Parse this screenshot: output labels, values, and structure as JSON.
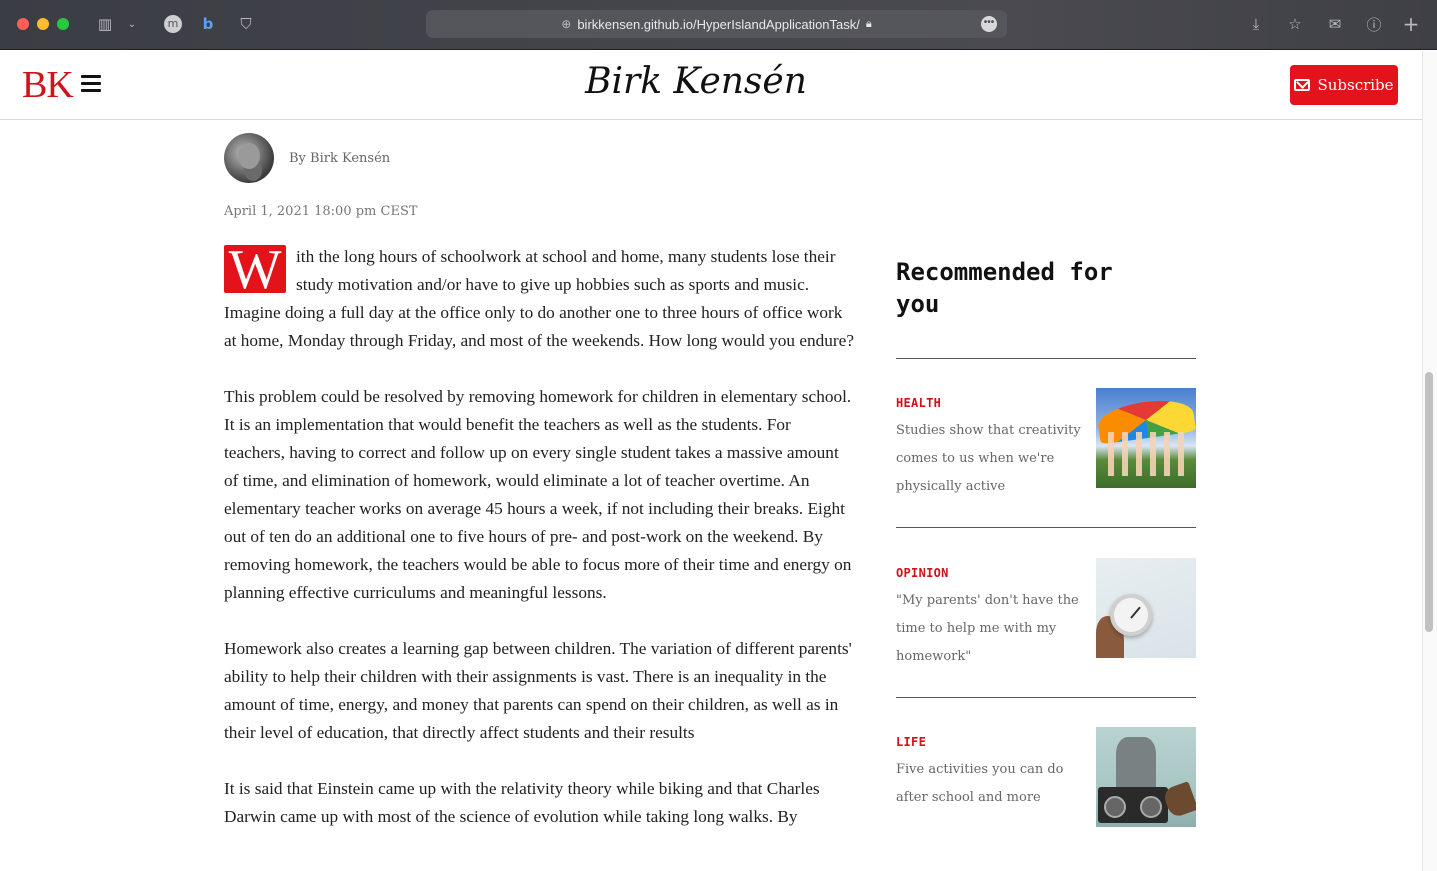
{
  "browser": {
    "url": "birkkensen.github.io/HyperIslandApplicationTask/",
    "more_label": "•••"
  },
  "header": {
    "logo": "BK",
    "site_title": "Birk Kensén",
    "subscribe_label": "Subscribe"
  },
  "article": {
    "author": "By Birk Kensén",
    "date": "April 1, 2021 18:00 pm CEST",
    "dropcap": "W",
    "paragraphs": [
      "ith the long hours of schoolwork at school and home, many students lose their study motivation and/or have to give up hobbies such as sports and music. Imagine doing a full day at the office only to do another one to three hours of office work at home, Monday through Friday, and most of the weekends. How long would you endure?",
      "This problem could be resolved by removing homework for children in elementary school. It is an implementation that would benefit the teachers as well as the students. For teachers, having to correct and follow up on every single student takes a massive amount of time, and elimination of homework, would eliminate a lot of teacher overtime. An elementary teacher works on average 45 hours a week, if not including their breaks. Eight out of ten do an additional one to five hours of pre- and post-work on the weekend. By removing homework, the teachers would be able to focus more of their time and energy on planning effective curriculums and meaningful lessons.",
      "Homework also creates a learning gap between children. The variation of different parents' ability to help their children with their assignments is vast. There is an inequality in the amount of time, energy, and money that parents can spend on their children, as well as in their level of education, that directly affect students and their results",
      "It is said that Einstein came up with the relativity theory while biking and that Charles Darwin came up with most of the science of evolution while taking long walks. By"
    ]
  },
  "sidebar": {
    "title": "Recommended for you",
    "items": [
      {
        "category": "HEALTH",
        "headline": "Studies show that creativity comes to us when we're physically active"
      },
      {
        "category": "OPINION",
        "headline": "\"My parents' don't have the time to help me with my homework\""
      },
      {
        "category": "LIFE",
        "headline": "Five activities you can do after school and more"
      }
    ]
  },
  "colors": {
    "accent": "#e4121b",
    "category": "#d0121b"
  }
}
